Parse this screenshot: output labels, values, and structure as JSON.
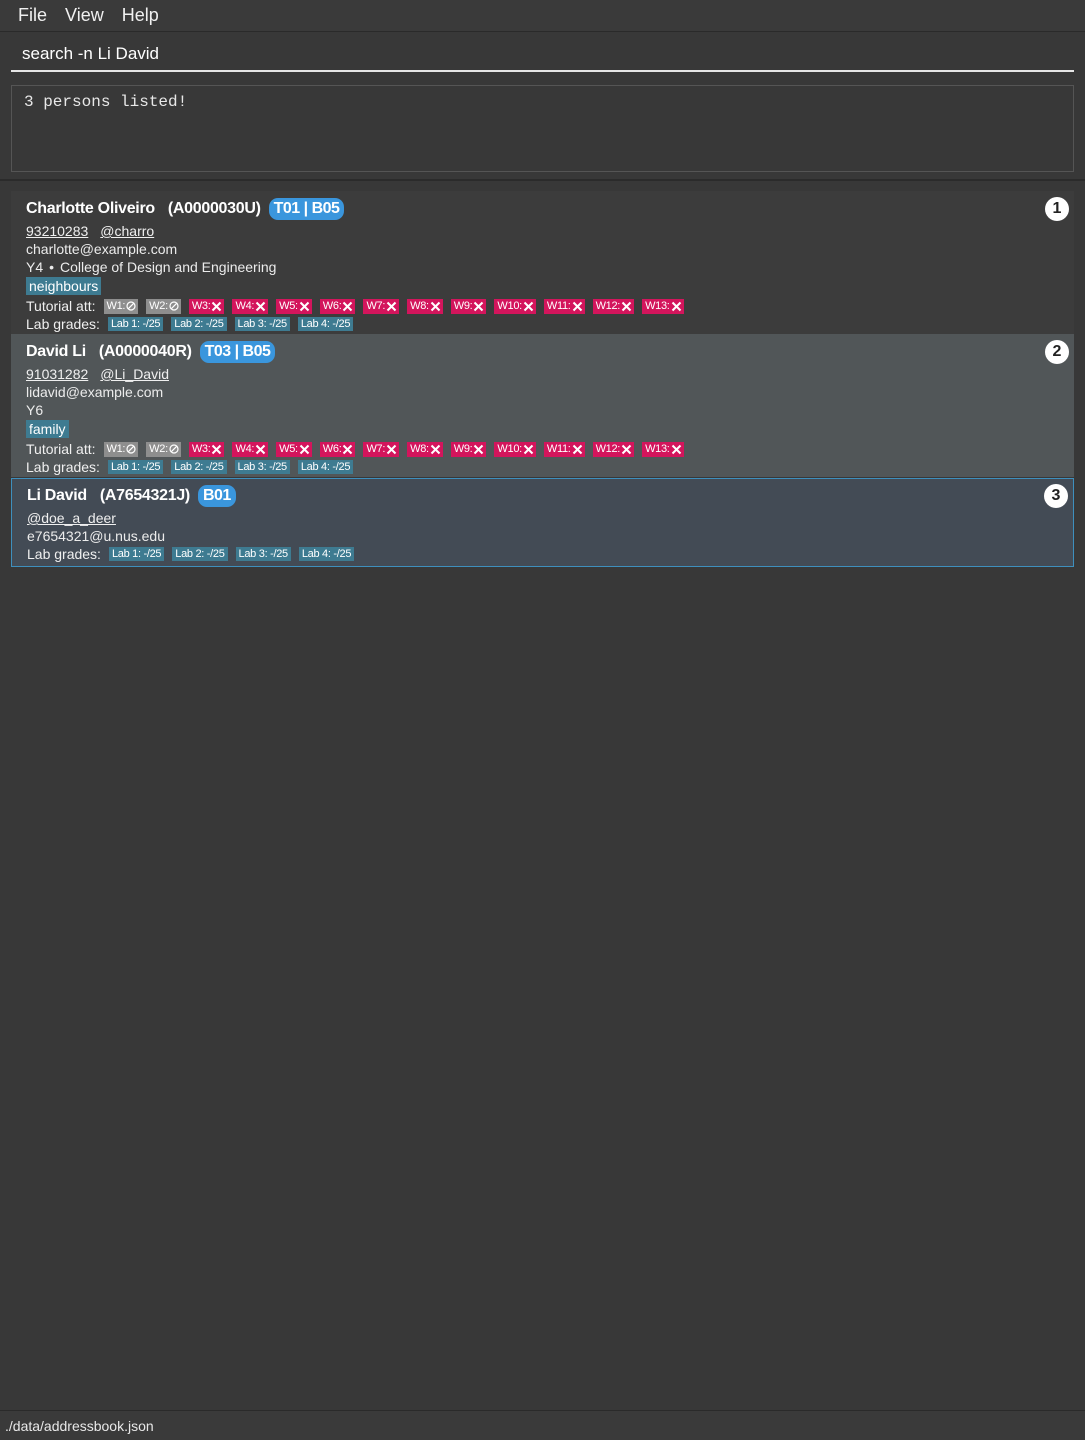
{
  "menu": {
    "items": [
      {
        "label": "File"
      },
      {
        "label": "View"
      },
      {
        "label": "Help"
      }
    ]
  },
  "command": {
    "value": "search -n Li David"
  },
  "result": {
    "text": "3 persons listed!"
  },
  "persons": [
    {
      "index": "1",
      "name": "Charlotte Oliveiro",
      "student_id": "(A0000030U)",
      "group": "T01 | B05",
      "phone": "93210283",
      "telegram": "@charro",
      "email": "charlotte@example.com",
      "year": "Y4",
      "faculty": "College of Design and Engineering",
      "tag": "neighbours",
      "attendance_label": "Tutorial att:",
      "attendance": [
        {
          "week": "W1:",
          "status": "not-applicable"
        },
        {
          "week": "W2:",
          "status": "not-applicable"
        },
        {
          "week": "W3:",
          "status": "absent"
        },
        {
          "week": "W4:",
          "status": "absent"
        },
        {
          "week": "W5:",
          "status": "absent"
        },
        {
          "week": "W6:",
          "status": "absent"
        },
        {
          "week": "W7:",
          "status": "absent"
        },
        {
          "week": "W8:",
          "status": "absent"
        },
        {
          "week": "W9:",
          "status": "absent"
        },
        {
          "week": "W10:",
          "status": "absent"
        },
        {
          "week": "W11:",
          "status": "absent"
        },
        {
          "week": "W12:",
          "status": "absent"
        },
        {
          "week": "W13:",
          "status": "absent"
        }
      ],
      "lab_label": "Lab grades:",
      "labs": [
        "Lab 1: -/25",
        "Lab 2: -/25",
        "Lab 3: -/25",
        "Lab 4: -/25"
      ]
    },
    {
      "index": "2",
      "name": "David Li",
      "student_id": "(A0000040R)",
      "group": "T03 | B05",
      "phone": "91031282",
      "telegram": "@Li_David",
      "email": "lidavid@example.com",
      "year": "Y6",
      "tag": "family",
      "attendance_label": "Tutorial att:",
      "attendance": [
        {
          "week": "W1:",
          "status": "not-applicable"
        },
        {
          "week": "W2:",
          "status": "not-applicable"
        },
        {
          "week": "W3:",
          "status": "absent"
        },
        {
          "week": "W4:",
          "status": "absent"
        },
        {
          "week": "W5:",
          "status": "absent"
        },
        {
          "week": "W6:",
          "status": "absent"
        },
        {
          "week": "W7:",
          "status": "absent"
        },
        {
          "week": "W8:",
          "status": "absent"
        },
        {
          "week": "W9:",
          "status": "absent"
        },
        {
          "week": "W10:",
          "status": "absent"
        },
        {
          "week": "W11:",
          "status": "absent"
        },
        {
          "week": "W12:",
          "status": "absent"
        },
        {
          "week": "W13:",
          "status": "absent"
        }
      ],
      "lab_label": "Lab grades:",
      "labs": [
        "Lab 1: -/25",
        "Lab 2: -/25",
        "Lab 3: -/25",
        "Lab 4: -/25"
      ]
    },
    {
      "index": "3",
      "name": "Li David",
      "student_id": "(A7654321J)",
      "group": "B01",
      "telegram": "@doe_a_deer",
      "email": "e7654321@u.nus.edu",
      "lab_label": "Lab grades:",
      "labs": [
        "Lab 1: -/25",
        "Lab 2: -/25",
        "Lab 3: -/25",
        "Lab 4: -/25"
      ]
    }
  ],
  "status_bar": {
    "path": "./data/addressbook.json"
  },
  "colors": {
    "background": "#383838",
    "group_badge": "#3a96dd",
    "tag": "#3e7b91",
    "absent": "#d3155c",
    "not_applicable": "#8e8e8e",
    "selected_border": "#3e8fbd"
  },
  "icons": {
    "not_applicable": "circle-slash-icon",
    "absent": "cross-icon"
  }
}
